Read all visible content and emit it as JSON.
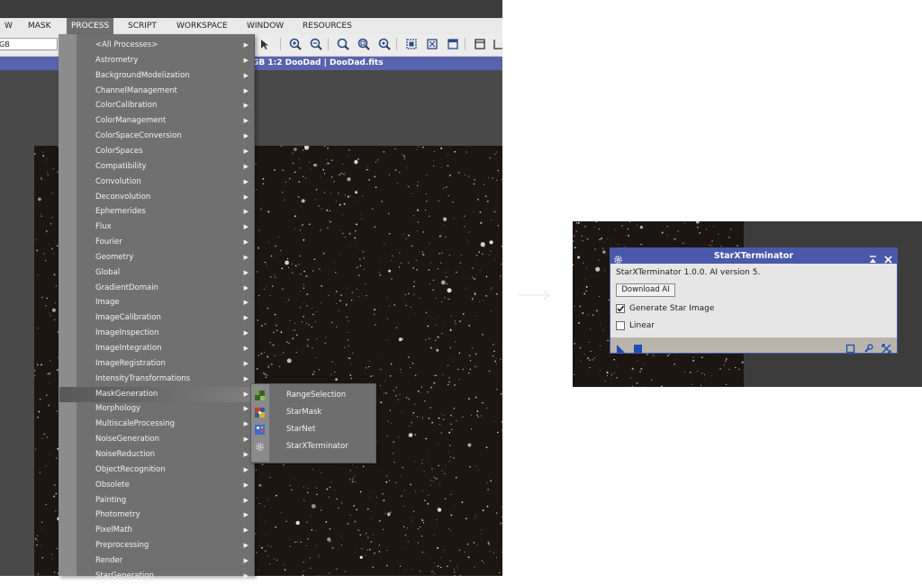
{
  "menubar": {
    "items": [
      "W",
      "MASK",
      "PROCESS",
      "SCRIPT",
      "WORKSPACE",
      "WINDOW",
      "RESOURCES"
    ],
    "active": "PROCESS"
  },
  "toolbar": {
    "view_select_value": "GB"
  },
  "window": {
    "title": "GB 1:2 DooDad | DooDad.fits"
  },
  "process_menu": {
    "items": [
      "<All Processes>",
      "Astrometry",
      "BackgroundModelization",
      "ChannelManagement",
      "ColorCalibration",
      "ColorManagement",
      "ColorSpaceConversion",
      "ColorSpaces",
      "Compatibility",
      "Convolution",
      "Deconvolution",
      "Ephemerides",
      "Flux",
      "Fourier",
      "Geometry",
      "Global",
      "GradientDomain",
      "Image",
      "ImageCalibration",
      "ImageInspection",
      "ImageIntegration",
      "ImageRegistration",
      "IntensityTransformations",
      "MaskGeneration",
      "Morphology",
      "MultiscaleProcessing",
      "NoiseGeneration",
      "NoiseReduction",
      "ObjectRecognition",
      "Obsolete",
      "Painting",
      "Photometry",
      "PixelMath",
      "Preprocessing",
      "Render",
      "StarGeneration"
    ],
    "highlighted": "MaskGeneration",
    "arrow_glyph": "▶"
  },
  "mask_generation_submenu": {
    "items": [
      {
        "label": "RangeSelection",
        "icon": "range-selection-icon"
      },
      {
        "label": "StarMask",
        "icon": "star-mask-icon"
      },
      {
        "label": "StarNet",
        "icon": "starnet-icon"
      },
      {
        "label": "StarXTerminator",
        "icon": "gear-icon"
      }
    ]
  },
  "dialog": {
    "title": "StarXTerminator",
    "version_text": "StarXTerminator 1.0.0. AI version 5.",
    "download_button": "Download AI",
    "checkboxes": [
      {
        "label": "Generate Star Image",
        "checked": true
      },
      {
        "label": "Linear",
        "checked": false
      }
    ]
  },
  "colors": {
    "title_bar": "#5763ad",
    "menu_bg": "#707070",
    "dialog_bg": "#e6e6e6",
    "dialog_footer": "#b9b5ac",
    "icon_blue": "#1b4fb3"
  }
}
